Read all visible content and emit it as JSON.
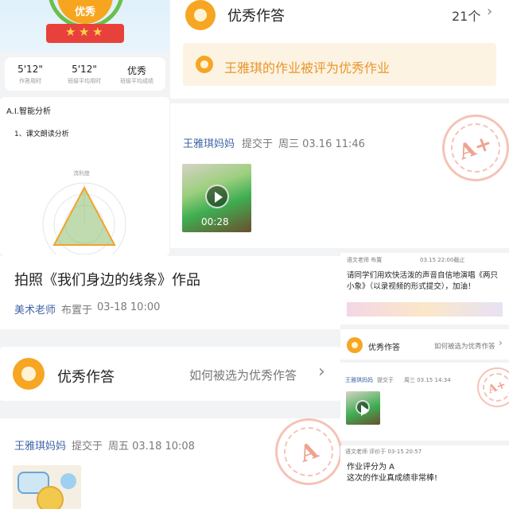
{
  "top_left": {
    "badge": "优秀",
    "stats": [
      {
        "value": "5'12\"",
        "label": "作答用时"
      },
      {
        "value": "5'12\"",
        "label": "班级平均用时"
      },
      {
        "value": "优秀",
        "label": "班级平均成绩"
      }
    ]
  },
  "ai_analysis": {
    "title": "A.I.智能分析",
    "item": "1、课文朗读分析",
    "radar_label": "流利度"
  },
  "excellent_summary": {
    "title": "优秀作答",
    "count": "21个",
    "notice": "王雅琪的作业被评为优秀作业"
  },
  "submission_video": {
    "author": "王雅琪妈妈",
    "action": "提交于",
    "time": "周三 03.16 11:46",
    "duration": "00:28",
    "grade": "A+"
  },
  "assignment": {
    "title": "拍照《我们身边的线条》作品",
    "teacher": "美术老师",
    "action": "布置于",
    "time": "03-18 10:00"
  },
  "excellent_header": {
    "title": "优秀作答",
    "link": "如何被选为优秀作答"
  },
  "submission_photo": {
    "author": "王雅琪妈妈",
    "action": "提交于",
    "time": "周五 03.18 10:08",
    "grade": "A"
  },
  "right_small": {
    "meta_left": "语文老师 布置",
    "meta_right": "03.15 22:00截止",
    "text": "请同学们用欢快活泼的声音自信地演唱《两只小象》（以录视频的形式提交），加油！",
    "header_title": "优秀作答",
    "header_link": "如何被选为优秀作答",
    "sub_author": "王雅琪妈妈",
    "sub_action": "提交于",
    "sub_time": "周三 03.15 14:34",
    "grade": "A+",
    "comment_meta": "语文老师 评价于 03-15 20:57",
    "comment_line1": "作业评分为 A",
    "comment_line2": "这次的作业真成绩非常棒!"
  },
  "colors": {
    "accent": "#f6a623",
    "link": "#3f65a8",
    "stamp": "#e87a60"
  }
}
